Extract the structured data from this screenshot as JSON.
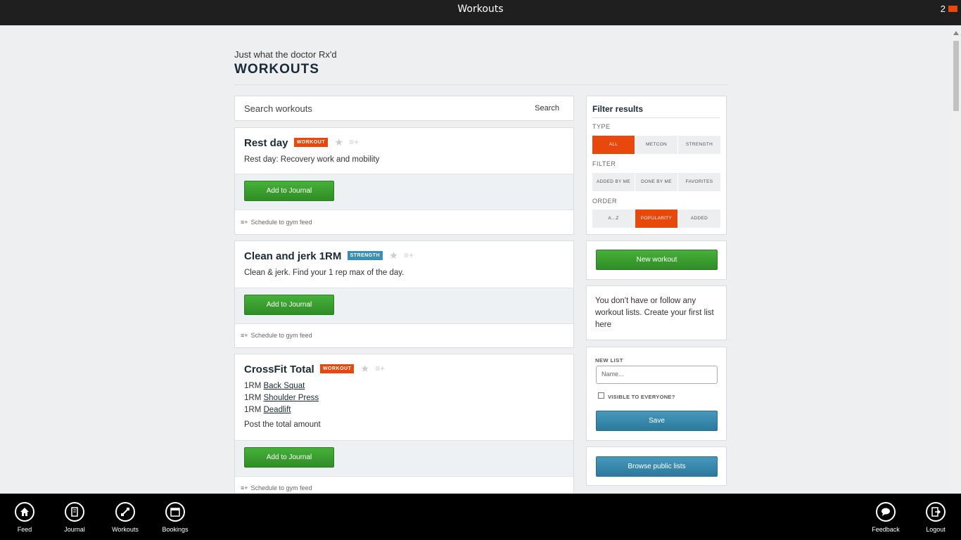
{
  "titlebar": {
    "title": "Workouts",
    "count": "2"
  },
  "header": {
    "tagline": "Just what the doctor Rx'd",
    "title": "WORKOUTS"
  },
  "search": {
    "placeholder": "Search workouts",
    "button": "Search"
  },
  "workouts": [
    {
      "title": "Rest day",
      "badge": "WORKOUT",
      "desc": "Rest day: Recovery work and mobility",
      "add_label": "Add to Journal",
      "schedule_label": "Schedule to gym feed"
    },
    {
      "title": "Clean and jerk 1RM",
      "badge": "STRENGTH",
      "desc": "Clean & jerk. Find your 1 rep max of the day.",
      "add_label": "Add to Journal",
      "schedule_label": "Schedule to gym feed"
    },
    {
      "title": "CrossFit Total",
      "badge": "WORKOUT",
      "lines": [
        {
          "prefix": "1RM",
          "link": "Back Squat"
        },
        {
          "prefix": "1RM",
          "link": "Shoulder Press"
        },
        {
          "prefix": "1RM",
          "link": "Deadlift"
        }
      ],
      "desc": "Post the total amount",
      "add_label": "Add to Journal",
      "schedule_label": "Schedule to gym feed"
    }
  ],
  "filter": {
    "title": "Filter results",
    "type_label": "TYPE",
    "type_options": [
      "ALL",
      "METCON",
      "STRENGTH"
    ],
    "type_selected": "ALL",
    "filter_label": "FILTER",
    "filter_options": [
      "ADDED BY ME",
      "DONE BY ME",
      "FAVORITES"
    ],
    "order_label": "ORDER",
    "order_options": [
      "A...Z",
      "POPULARITY",
      "ADDED"
    ],
    "order_selected": "POPULARITY"
  },
  "new_workout_label": "New workout",
  "lists_info": "You don't have or follow any workout lists. Create your first list here",
  "new_list": {
    "label": "NEW LIST",
    "placeholder": "Name...",
    "visible_label": "VISIBLE TO EVERYONE?",
    "save_label": "Save"
  },
  "browse_label": "Browse public lists",
  "appbar": {
    "feed": "Feed",
    "journal": "Journal",
    "workouts": "Workouts",
    "bookings": "Bookings",
    "feedback": "Feedback",
    "logout": "Logout"
  },
  "colors": {
    "accent": "#e8480c",
    "green": "#3a9e2e",
    "blue": "#3a8fb3",
    "dark": "#1a2a36"
  }
}
